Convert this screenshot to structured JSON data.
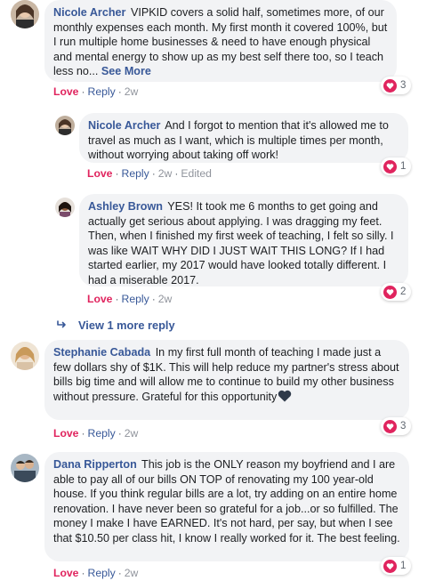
{
  "comments": [
    {
      "author": "Nicole Archer",
      "text": "VIPKID covers a solid half, sometimes more, of our monthly expenses each month. My first month it covered 100%, but I run multiple home businesses & need to have enough physical and mental energy to show up as my best self there too, so I teach less no...",
      "see_more": "See More",
      "love": "Love",
      "reply": "Reply",
      "time": "2w",
      "reactions": "3"
    },
    {
      "author": "Nicole Archer",
      "text": "And I forgot to mention that it's allowed me to travel as much as I want, which is multiple times per month, without worrying about taking off work!",
      "love": "Love",
      "reply": "Reply",
      "time": "2w",
      "edited": "Edited",
      "reactions": "1"
    },
    {
      "author": "Ashley Brown",
      "text": "YES! It took me 6 months to get going and actually get serious about applying. I was dragging my feet. Then, when I finished my first week of teaching, I felt so silly. I was like WAIT WHY DID I JUST WAIT THIS LONG? If I had started earlier, my 2017 would have looked totally different. I had a miserable 2017.",
      "love": "Love",
      "reply": "Reply",
      "time": "2w",
      "reactions": "2"
    },
    {
      "author": "Stephanie Cabada",
      "text": "In my first full month of teaching I made just a few dollars shy of $1K. This will help reduce my partner's stress about bills big time and will allow me to continue to build my other business without pressure. Grateful for this opportunity",
      "love": "Love",
      "reply": "Reply",
      "time": "2w",
      "reactions": "3"
    },
    {
      "author": "Dana Ripperton",
      "text": "This job is the ONLY reason my boyfriend and I are able to pay all of our bills ON TOP of renovating my 100 year-old house. If you think regular bills are a lot, try adding on an entire home renovation. I have never been so grateful for a job...or so fulfilled. The money I make I have EARNED. It's not hard, per say, but when I see that $10.50 per class hit, I know I really worked for it. The best feeling.",
      "love": "Love",
      "reply": "Reply",
      "time": "2w",
      "reactions": "1"
    }
  ],
  "view_more_replies": "View 1 more reply",
  "colors": {
    "link": "#385898",
    "love": "#e0245e",
    "bubble": "#f2f3f5"
  }
}
